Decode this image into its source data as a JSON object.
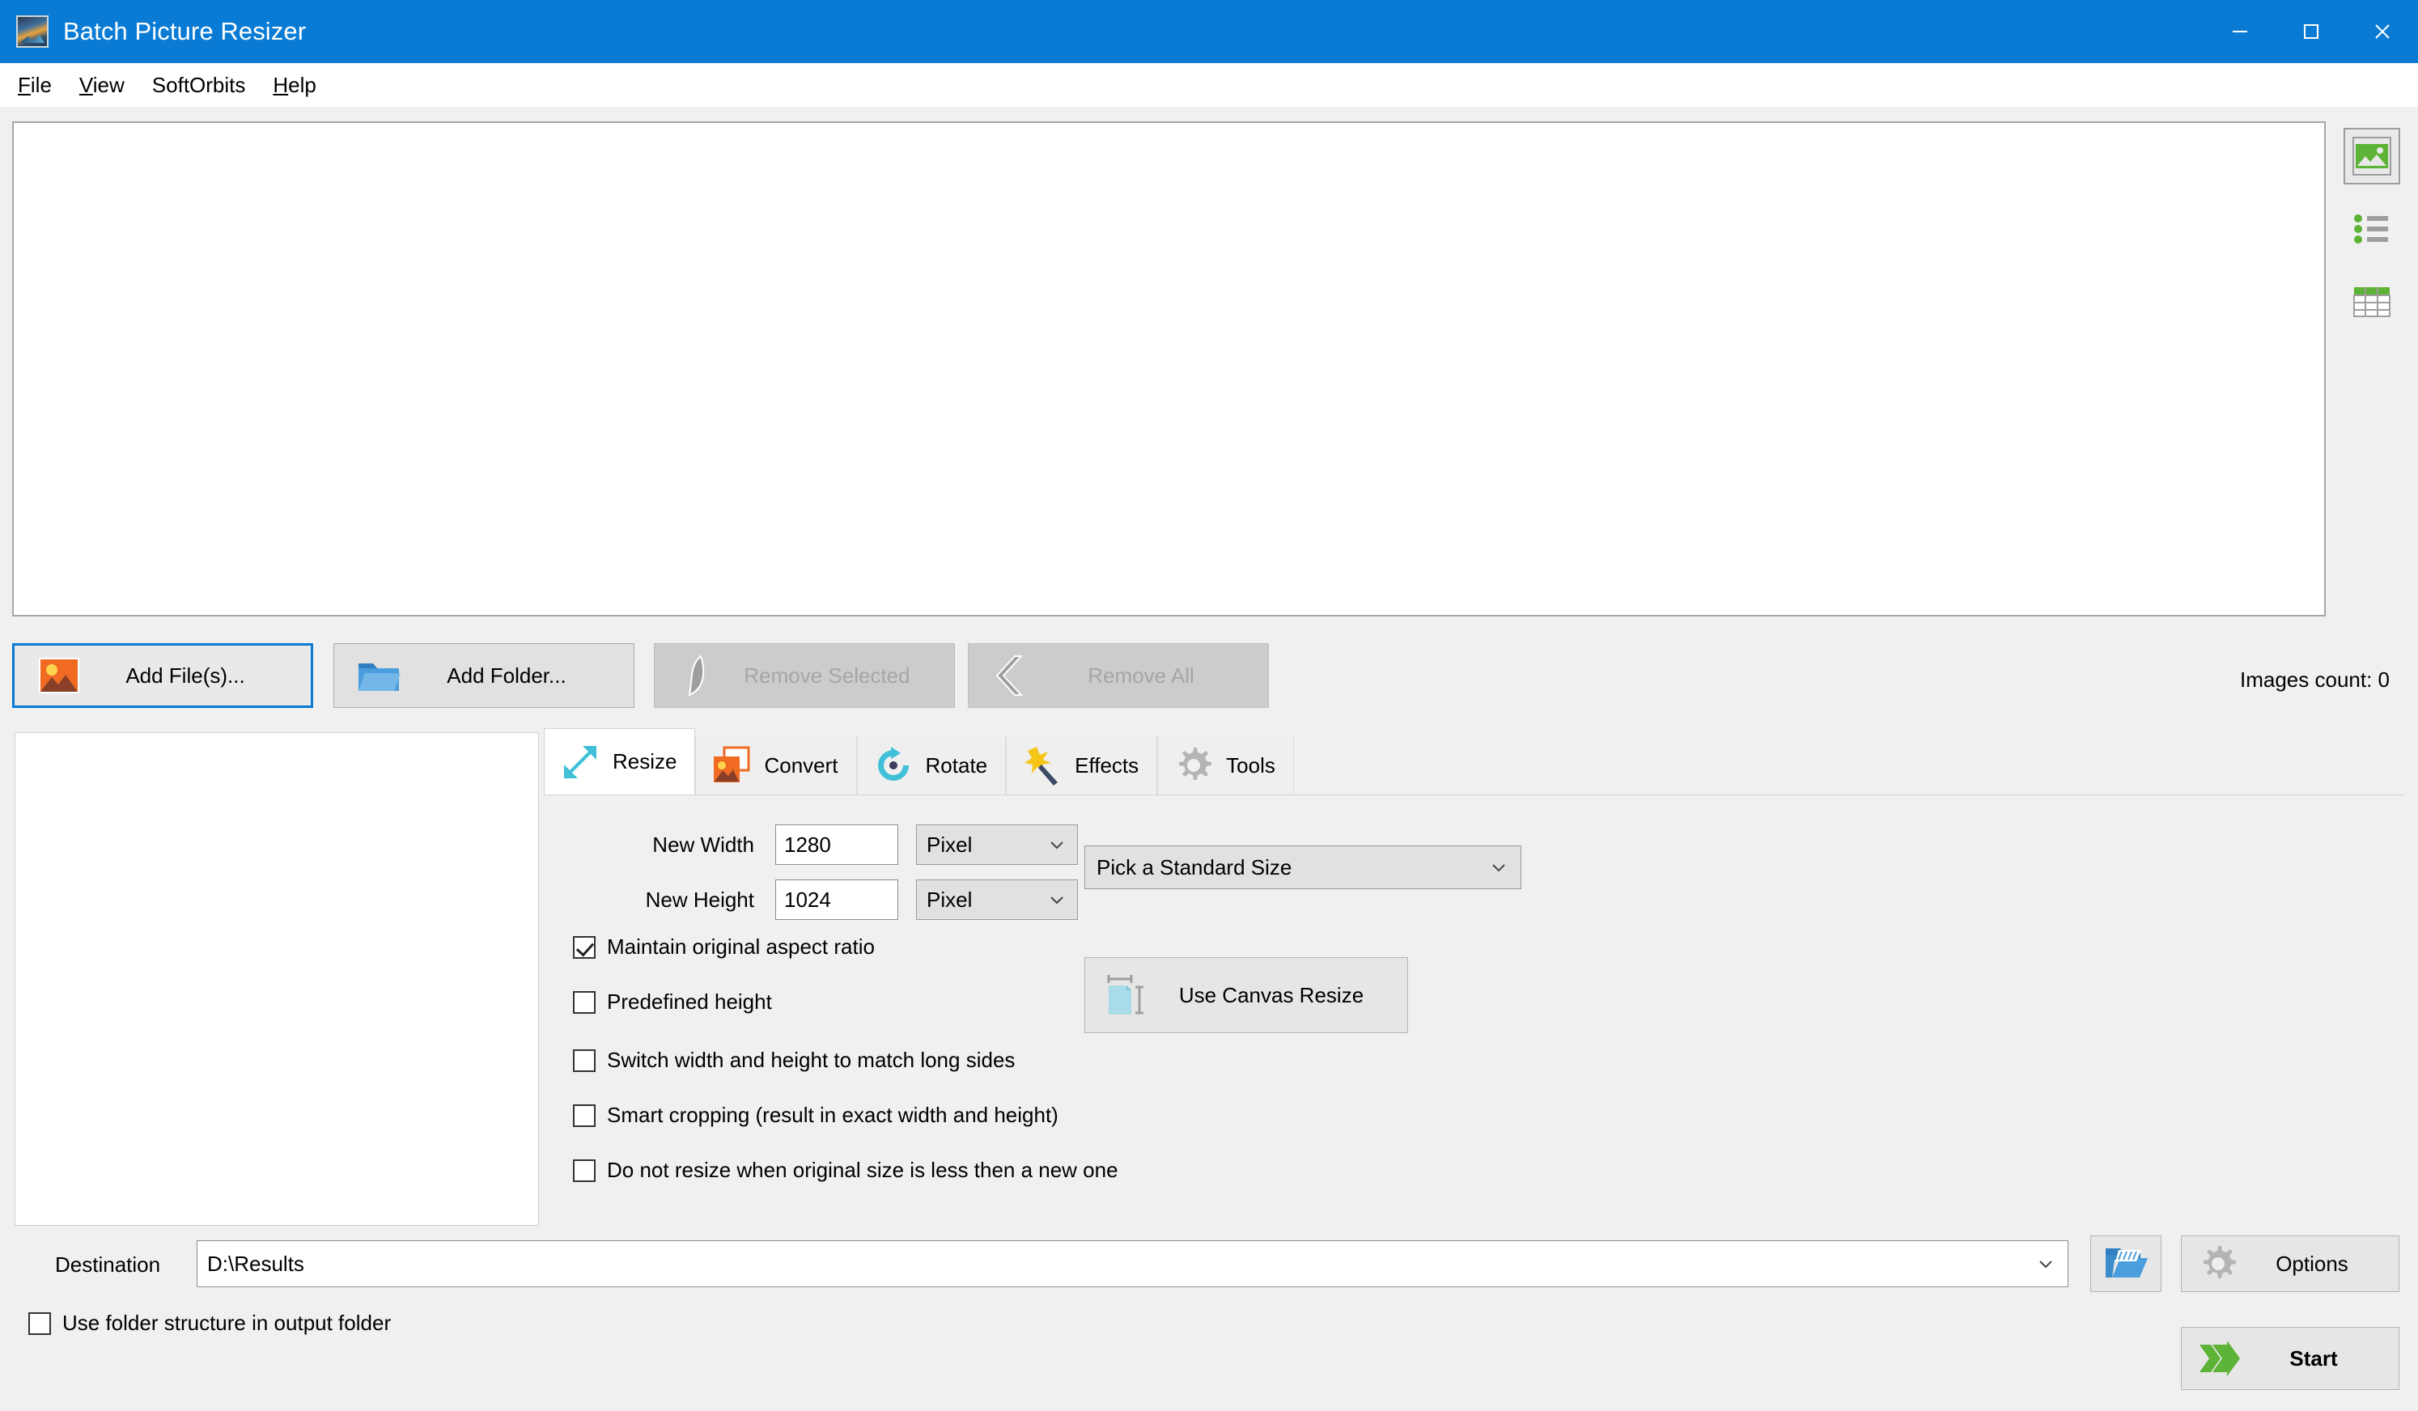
{
  "window": {
    "title": "Batch Picture Resizer",
    "icon": "app-picture-icon",
    "minimize_label": "Minimize",
    "maximize_label": "Maximize",
    "close_label": "Close"
  },
  "menu": {
    "items": [
      {
        "label": "File",
        "mnemonic": "F"
      },
      {
        "label": "View",
        "mnemonic": "V"
      },
      {
        "label": "SoftOrbits",
        "mnemonic": ""
      },
      {
        "label": "Help",
        "mnemonic": "H"
      }
    ]
  },
  "viewmodes": [
    {
      "name": "thumbnail-view",
      "selected": true
    },
    {
      "name": "list-view",
      "selected": false
    },
    {
      "name": "details-view",
      "selected": false
    }
  ],
  "toolbar": {
    "add_files_label": "Add File(s)...",
    "add_folder_label": "Add Folder...",
    "remove_selected_label": "Remove Selected",
    "remove_all_label": "Remove All",
    "images_count_label": "Images count: 0"
  },
  "tabs": [
    {
      "label": "Resize",
      "icon": "resize-arrows-icon",
      "active": true
    },
    {
      "label": "Convert",
      "icon": "convert-image-icon",
      "active": false
    },
    {
      "label": "Rotate",
      "icon": "rotate-arrow-icon",
      "active": false
    },
    {
      "label": "Effects",
      "icon": "magic-wand-icon",
      "active": false
    },
    {
      "label": "Tools",
      "icon": "gear-icon",
      "active": false
    }
  ],
  "resize": {
    "width_label": "New Width",
    "width_value": "1280",
    "width_unit": "Pixel",
    "height_label": "New Height",
    "height_value": "1024",
    "height_unit": "Pixel",
    "standard_size_value": "Pick a Standard Size",
    "canvas_resize_label": "Use Canvas Resize",
    "checkboxes": [
      {
        "label": "Maintain original aspect ratio",
        "checked": true
      },
      {
        "label": "Predefined height",
        "checked": false
      },
      {
        "label": "Switch width and height to match long sides",
        "checked": false
      },
      {
        "label": "Smart cropping (result in exact width and height)",
        "checked": false
      },
      {
        "label": "Do not resize when original size is less then a new one",
        "checked": false
      }
    ]
  },
  "bottom": {
    "destination_label": "Destination",
    "destination_value": "D:\\Results",
    "browse_label": "Browse",
    "options_label": "Options",
    "start_label": "Start",
    "folder_structure_label": "Use folder structure in output folder",
    "folder_structure_checked": false
  },
  "colors": {
    "titlebar": "#0a7bd4",
    "accent_green": "#5cb335",
    "accent_cyan": "#3fc0d8",
    "window_bg": "#f0f0f0"
  }
}
